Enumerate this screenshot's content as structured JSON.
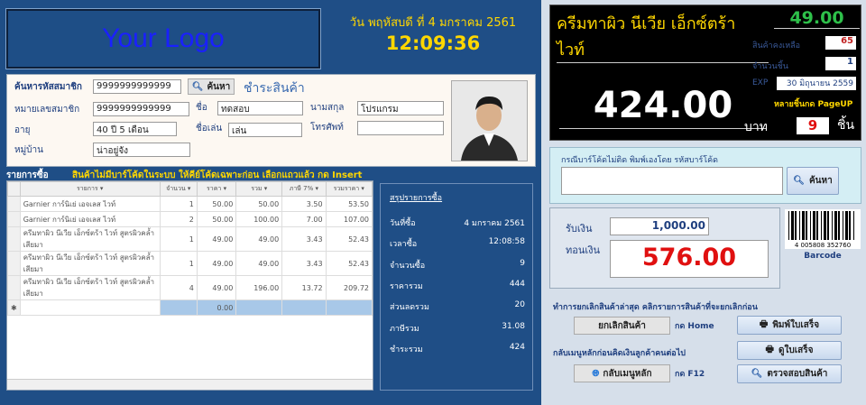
{
  "header": {
    "logo": "Your Logo",
    "date": "วัน พฤหัสบดี ที่ 4 มกราคม 2561",
    "time": "12:09:36"
  },
  "member": {
    "search_label": "ค้นหารหัสสมาชิก",
    "search_value": "9999999999999",
    "search_button": "ค้นหา",
    "pay_title": "ชำระสินค้า",
    "id_label": "หมายเลขสมาชิก",
    "id_value": "9999999999999",
    "name_label": "ชื่อ",
    "name_value": "ทดสอบ",
    "surname_label": "นามสกุล",
    "surname_value": "โปรแกรม",
    "age_label": "อายุ",
    "age_value": "40 ปี  5 เดือน",
    "nick_label": "ชื่อเล่น",
    "nick_value": "เล่น",
    "phone_label": "โทรศัพท์",
    "phone_value": "",
    "village_label": "หมู่บ้าน",
    "village_value": "น่าอยู่จัง"
  },
  "list": {
    "title": "รายการซื้อ",
    "note": "สินค้าไม่มีบาร์โค้ดในระบบ ให้คีย์โค้ดเฉพาะก่อน เลือกแถวแล้ว กด Insert",
    "columns": [
      "รายการ",
      "จำนวน",
      "ราคา",
      "รวม",
      "ภาษี 7%",
      "รวมราคา"
    ],
    "rows": [
      [
        "Garnier การ์นิเย่ เอจเลส ไวท์",
        "1",
        "50.00",
        "50.00",
        "3.50",
        "53.50"
      ],
      [
        "Garnier การ์นิเย่ เอจเลส ไวท์",
        "2",
        "50.00",
        "100.00",
        "7.00",
        "107.00"
      ],
      [
        "ครีมทาผิว นีเวีย เอ็กซ์ตร้า ไวท์ สูตรผิวคล้ำเสียมา",
        "1",
        "49.00",
        "49.00",
        "3.43",
        "52.43"
      ],
      [
        "ครีมทาผิว นีเวีย เอ็กซ์ตร้า ไวท์ สูตรผิวคล้ำเสียมา",
        "1",
        "49.00",
        "49.00",
        "3.43",
        "52.43"
      ],
      [
        "ครีมทาผิว นีเวีย เอ็กซ์ตร้า ไวท์ สูตรผิวคล้ำเสียมา",
        "4",
        "49.00",
        "196.00",
        "13.72",
        "209.72"
      ]
    ],
    "new_row_marker": "✱",
    "new_row_price": "0.00"
  },
  "summary": {
    "title": "สรุปรายการซื้อ",
    "rows": [
      {
        "label": "วันที่ซื้อ",
        "value": "4 มกราคม 2561"
      },
      {
        "label": "เวลาซื้อ",
        "value": "12:08:58"
      },
      {
        "label": "จำนวนซื้อ",
        "value": "9"
      },
      {
        "label": "ราคารวม",
        "value": "444"
      },
      {
        "label": "ส่วนลดรวม",
        "value": "20"
      },
      {
        "label": "ภาษีรวม",
        "value": "31.08"
      },
      {
        "label": "ชำระรวม",
        "value": "424"
      }
    ]
  },
  "display": {
    "product": "ครีมทาผิว นีเวีย เอ็กซ์ตร้า ไวท์",
    "price": "49.00",
    "total": "424.00",
    "stock_label": "สินค้าคงเหลือ",
    "stock": "65",
    "qty_label": "จำนวนชิ้น",
    "qty": "1",
    "exp_label": "EXP",
    "exp": "30 มิถุนายน 2559",
    "pageup_hint": "หลายชิ้นกด PageUP",
    "baht": "บาท",
    "pieces": "9",
    "piece_unit": "ชิ้น"
  },
  "barcode": {
    "label": "กรณีบาร์โค้ดไม่ติด พิมพ์เองโดย รหัสบาร์โค้ด",
    "value": "",
    "button": "ค้นหา",
    "image_digits": "4 005808 352760",
    "caption": "Barcode"
  },
  "payment": {
    "received_label": "รับเงิน",
    "received": "1,000.00",
    "change_label": "ทอนเงิน",
    "change": "576.00"
  },
  "actions": {
    "cancel_hint": "ทำการยกเลิกสินค้าล่าสุด คลิกรายการสินค้าที่จะยกเลิกก่อน",
    "cancel_button": "ยกเลิกสินค้า",
    "cancel_key": "กด Home",
    "back_hint": "กลับเมนูหลักก่อนคิดเงินลูกค้าคนต่อไป",
    "back_button": "กลับเมนูหลัก",
    "back_key": "กด F12",
    "print_button": "พิมพ์ใบเสร็จ",
    "view_button": "ดูใบเสร็จ",
    "check_button": "ตรวจสอบสินค้า"
  },
  "colors": {
    "navy": "#1f4e86",
    "yellow": "#ffd700",
    "red": "#e01010",
    "green": "#2ec04a"
  }
}
